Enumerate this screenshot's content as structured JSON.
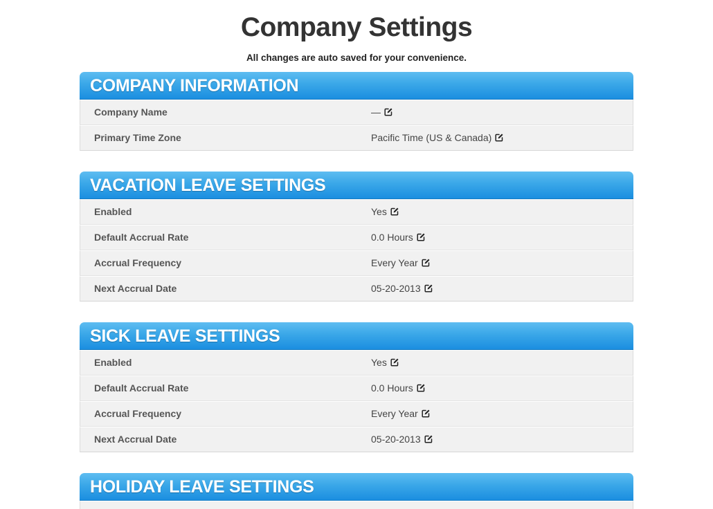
{
  "page": {
    "title": "Company Settings",
    "subtitle": "All changes are auto saved for your convenience."
  },
  "company_information": {
    "header": "COMPANY INFORMATION",
    "rows": [
      {
        "label": "Company Name",
        "value": "—"
      },
      {
        "label": "Primary Time Zone",
        "value": "Pacific Time (US & Canada)"
      }
    ]
  },
  "vacation_leave": {
    "header": "VACATION LEAVE SETTINGS",
    "rows": [
      {
        "label": "Enabled",
        "value": "Yes"
      },
      {
        "label": "Default Accrual Rate",
        "value": "0.0 Hours"
      },
      {
        "label": "Accrual Frequency",
        "value": "Every Year"
      },
      {
        "label": "Next Accrual Date",
        "value": "05-20-2013"
      }
    ]
  },
  "sick_leave": {
    "header": "SICK LEAVE SETTINGS",
    "rows": [
      {
        "label": "Enabled",
        "value": "Yes"
      },
      {
        "label": "Default Accrual Rate",
        "value": "0.0 Hours"
      },
      {
        "label": "Accrual Frequency",
        "value": "Every Year"
      },
      {
        "label": "Next Accrual Date",
        "value": "05-20-2013"
      }
    ]
  },
  "holiday_leave": {
    "header": "HOLIDAY LEAVE SETTINGS"
  },
  "icons": {
    "edit": "edit-icon"
  },
  "colors": {
    "header_blue_top": "#5ebdf1",
    "header_blue_bottom": "#1b8ee0",
    "row_background": "#f1f1f1"
  }
}
